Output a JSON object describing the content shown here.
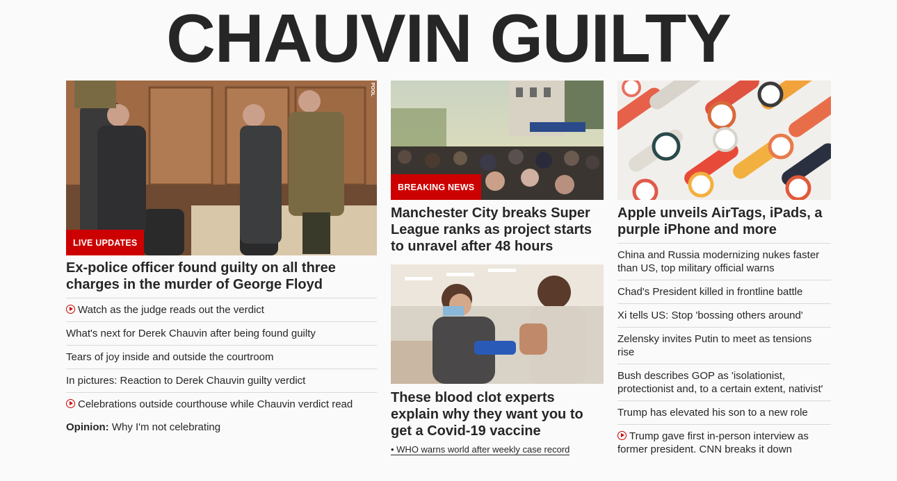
{
  "headline": "CHAUVIN GUILTY",
  "left": {
    "label": "LIVE UPDATES",
    "pool": "POOL",
    "title": "Ex-police officer found guilty on all three charges in the murder of George Floyd",
    "links": [
      {
        "text": "Watch as the judge reads out the verdict",
        "video": true
      },
      {
        "text": "What's next for Derek Chauvin after being found guilty",
        "video": false
      },
      {
        "text": "Tears of joy inside and outside the courtroom",
        "video": false
      },
      {
        "text": "In pictures: Reaction to Derek Chauvin guilty verdict",
        "video": false
      },
      {
        "text": "Celebrations outside courthouse while Chauvin verdict read",
        "video": true
      }
    ],
    "opinion_prefix": "Opinion:",
    "opinion_text": " Why I'm not celebrating"
  },
  "middle": {
    "story1": {
      "label": "BREAKING NEWS",
      "title": "Manchester City breaks Super League ranks as project starts to unravel after 48 hours"
    },
    "story2": {
      "title": "These blood clot experts explain why they want you to get a Covid-19 vaccine",
      "sublink": "• WHO warns world after weekly case record"
    }
  },
  "right": {
    "title": "Apple unveils AirTags, iPads, a purple iPhone and more",
    "links": [
      {
        "text": "China and Russia modernizing nukes faster than US, top military official warns",
        "video": false
      },
      {
        "text": "Chad's President killed in frontline battle",
        "video": false
      },
      {
        "text": "Xi tells US: Stop 'bossing others around'",
        "video": false
      },
      {
        "text": "Zelensky invites Putin to meet as tensions rise",
        "video": false
      },
      {
        "text": "Bush describes GOP as 'isolationist, protectionist and, to a certain extent, nativist'",
        "video": false
      },
      {
        "text": "Trump has elevated his son to a new role",
        "video": false
      },
      {
        "text": "Trump gave first in-person interview as former president. CNN breaks it down",
        "video": true
      }
    ]
  },
  "colors": {
    "accent": "#cc0000",
    "text": "#262626",
    "divider": "#d9d9d9"
  }
}
